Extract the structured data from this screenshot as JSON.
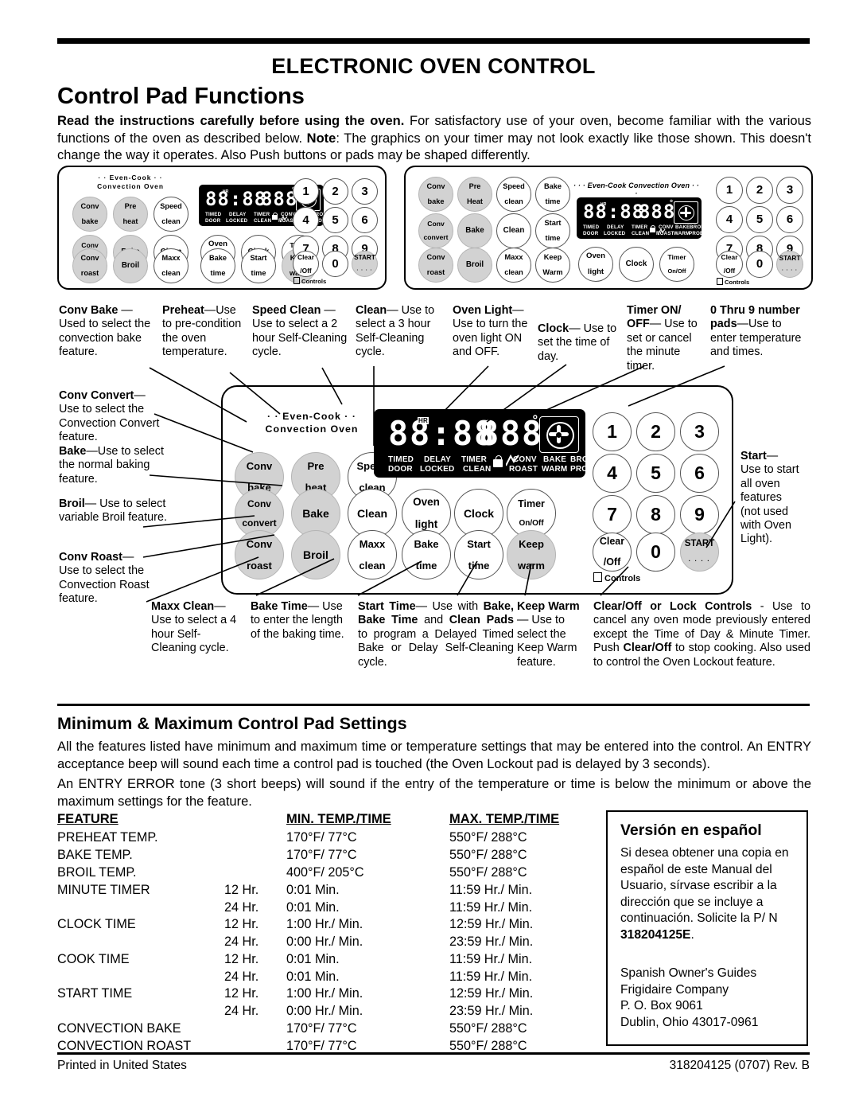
{
  "header": {
    "title": "ELECTRONIC OVEN CONTROL",
    "subtitle": "Control Pad Functions",
    "intro_bold": "Read the instructions carefully before using the oven.",
    "intro_rest": " For satisfactory use of your oven, become familiar with the various functions of the oven as described below. ",
    "intro_note_bold": "Note",
    "intro_note_rest": ": The  graphics on your timer may not look exactly like those shown. This doesn't change the way it operates. Also Push buttons or pads may be shaped differently."
  },
  "panel": {
    "brand_line1": "· · Even-Cook · ·",
    "brand_line2": "Convection Oven",
    "brand_inline": "·  ·  ·  Even-Cook Convection Oven  ·  ·  ·",
    "display": {
      "clock": "88:88",
      "hr_tag": "HR",
      "temp": "888",
      "degree": "°",
      "labels_row1": [
        "TIMED",
        "DELAY",
        "TIMER",
        "CONV",
        "BAKE",
        "BROIL"
      ],
      "labels_row2": [
        "DOOR",
        "LOCKED",
        "CLEAN",
        "ROAST",
        "WARM",
        "PROBE"
      ],
      "lock_icon": "lock-icon",
      "probe_icon": "probe-icon",
      "fan_icon": "convection-fan-icon"
    },
    "buttons": {
      "conv_bake": [
        "Conv",
        "bake"
      ],
      "pre_heat": [
        "Pre",
        "heat"
      ],
      "pre_heat_alt": [
        "Pre",
        "Heat"
      ],
      "speed_clean": [
        "Speed",
        "clean"
      ],
      "conv_convert": [
        "Conv",
        "convert"
      ],
      "bake": [
        "Bake"
      ],
      "clean": [
        "Clean"
      ],
      "conv_roast": [
        "Conv",
        "roast"
      ],
      "broil": [
        "Broil"
      ],
      "maxx_clean": [
        "Maxx",
        "clean"
      ],
      "oven_light": [
        "Oven",
        "light"
      ],
      "clock": [
        "Clock"
      ],
      "timer_onoff": [
        "Timer",
        "On/Off"
      ],
      "bake_time": [
        "Bake",
        "time"
      ],
      "start_time": [
        "Start",
        "time"
      ],
      "keep_warm": [
        "Keep",
        "warm"
      ],
      "keep_warm_alt": [
        "Keep",
        "Warm"
      ],
      "clear_off": [
        "Clear",
        "/Off"
      ],
      "start": "START",
      "start_dots": "· · · ·",
      "controls_label": "Controls",
      "numbers": [
        "1",
        "2",
        "3",
        "4",
        "5",
        "6",
        "7",
        "8",
        "9",
        "0"
      ]
    }
  },
  "callouts": {
    "conv_bake": {
      "term": "Conv Bake ",
      "dash": "— ",
      "body": "Used to select the convection bake feature."
    },
    "conv_convert": {
      "term": "Conv Convert",
      "dash": "—",
      "body": "Use to select the Convection Convert feature."
    },
    "bake": {
      "term": "Bake",
      "dash": "—",
      "body": "Use to select the normal baking feature."
    },
    "broil": {
      "term": "Broil",
      "dash": "— ",
      "body": "Use to select variable Broil feature."
    },
    "conv_roast": {
      "term": "Conv Roast",
      "dash": "—",
      "body": "Use to select the Convection Roast feature."
    },
    "preheat": {
      "term": "Preheat",
      "dash": "—",
      "body": "Use to pre-condition the oven temperature."
    },
    "speed_clean": {
      "term": "Speed Clean ",
      "dash": "— ",
      "body": "Use to select a 2 hour Self-Cleaning cycle."
    },
    "clean": {
      "term": "Clean",
      "dash": "— ",
      "body": "Use to select a 3 hour Self-Cleaning cycle."
    },
    "oven_light": {
      "term": "Oven Light",
      "dash": "— ",
      "body": "Use to turn the oven light ON and OFF."
    },
    "clock": {
      "term": "Clock",
      "dash": "— ",
      "body": "Use to set the time of day."
    },
    "timer": {
      "term": "Timer ON/ OFF",
      "dash": "— ",
      "body": "Use to set or cancel the minute timer."
    },
    "numpads": {
      "term": "0 Thru 9 number pads",
      "dash": "—",
      "body": "Use to enter temperature and times."
    },
    "start": {
      "term": "Start",
      "dash": "—",
      "body": "Use to start all oven features (not used with Oven Light)."
    },
    "maxx_clean": {
      "term": "Maxx Clean",
      "dash": "—",
      "body": "Use to select a 4 hour Self-Cleaning cycle."
    },
    "bake_time": {
      "term": "Bake Time",
      "dash": "— ",
      "body": "Use to enter the length of the baking time."
    },
    "start_time": {
      "term": "Start Time",
      "dash": "— ",
      "body": "Use with ",
      "b2": "Bake, Bake Time",
      "body2": " and ",
      "b3": "Clean Pads",
      "body3": " to program a Delayed Timed Bake or Delay Self-Cleaning cycle."
    },
    "keep_warm": {
      "term": "Keep Warm",
      "dash": " — ",
      "body": "Use to select the Keep Warm feature."
    },
    "clear_off": {
      "term": "Clear/Off or Lock Controls",
      "dash": " - ",
      "body": "Use to cancel any oven mode previously entered except the  Time of Day & Minute Timer. Push ",
      "b2": "Clear/Off",
      "body2": " to stop cooking. Also used to control the Oven Lockout feature."
    }
  },
  "minmax": {
    "heading": "Minimum & Maximum Control Pad Settings",
    "para1": "All the features listed have minimum and maximum time or temperature settings that may be entered into the control. An ENTRY acceptance beep will sound each time a control pad is touched (the Oven Lockout pad is delayed by 3 seconds).",
    "para2": "An ENTRY ERROR tone (3 short beeps) will sound if the entry of the temperature or time is below the minimum or above the maximum settings for the feature.",
    "columns": [
      "FEATURE",
      "MIN. TEMP./TIME",
      "MAX. TEMP./TIME"
    ],
    "rows": [
      {
        "feature": "PREHEAT TEMP.",
        "hr": "",
        "min": "170°F/ 77°C",
        "max": "550°F/ 288°C"
      },
      {
        "feature": "BAKE TEMP.",
        "hr": "",
        "min": "170°F/ 77°C",
        "max": "550°F/ 288°C"
      },
      {
        "feature": "BROIL TEMP.",
        "hr": "",
        "min": "400°F/ 205°C",
        "max": "550°F/ 288°C"
      },
      {
        "feature": "MINUTE TIMER",
        "hr": "12 Hr.",
        "min": "0:01 Min.",
        "max": "11:59 Hr./ Min."
      },
      {
        "feature": "",
        "hr": "24 Hr.",
        "min": "0:01 Min.",
        "max": "11:59 Hr./ Min."
      },
      {
        "feature": "CLOCK TIME",
        "hr": "12 Hr.",
        "min": "1:00 Hr./ Min.",
        "max": "12:59 Hr./ Min."
      },
      {
        "feature": "",
        "hr": "24 Hr.",
        "min": "0:00 Hr./ Min.",
        "max": "23:59 Hr./ Min."
      },
      {
        "feature": "COOK TIME",
        "hr": "12 Hr.",
        "min": "0:01 Min.",
        "max": "11:59 Hr./ Min."
      },
      {
        "feature": "",
        "hr": "24 Hr.",
        "min": "0:01 Min.",
        "max": "11:59 Hr./ Min."
      },
      {
        "feature": "START TIME",
        "hr": "12 Hr.",
        "min": "1:00 Hr./ Min.",
        "max": "12:59 Hr./ Min."
      },
      {
        "feature": "",
        "hr": "24 Hr.",
        "min": "0:00 Hr./ Min.",
        "max": "23:59 Hr./ Min."
      },
      {
        "feature": "CONVECTION BAKE",
        "hr": "",
        "min": "170°F/ 77°C",
        "max": "550°F/ 288°C"
      },
      {
        "feature": "CONVECTION ROAST",
        "hr": "",
        "min": "170°F/ 77°C",
        "max": "550°F/ 288°C"
      }
    ]
  },
  "spanish": {
    "title": "Versión en español",
    "body_a": "Si desea obtener una copia en español de este Manual del Usuario, sírvase escribir a la dirección que se incluye a continuación. Solicite la P/ N ",
    "part_number": "318204125E",
    "body_a_end": ".",
    "address": "Spanish Owner's Guides\nFrigidaire Company\nP. O. Box 9061\nDublin, Ohio  43017-0961"
  },
  "footer": {
    "left": "Printed in United States",
    "right": "318204125 (0707) Rev. B"
  }
}
